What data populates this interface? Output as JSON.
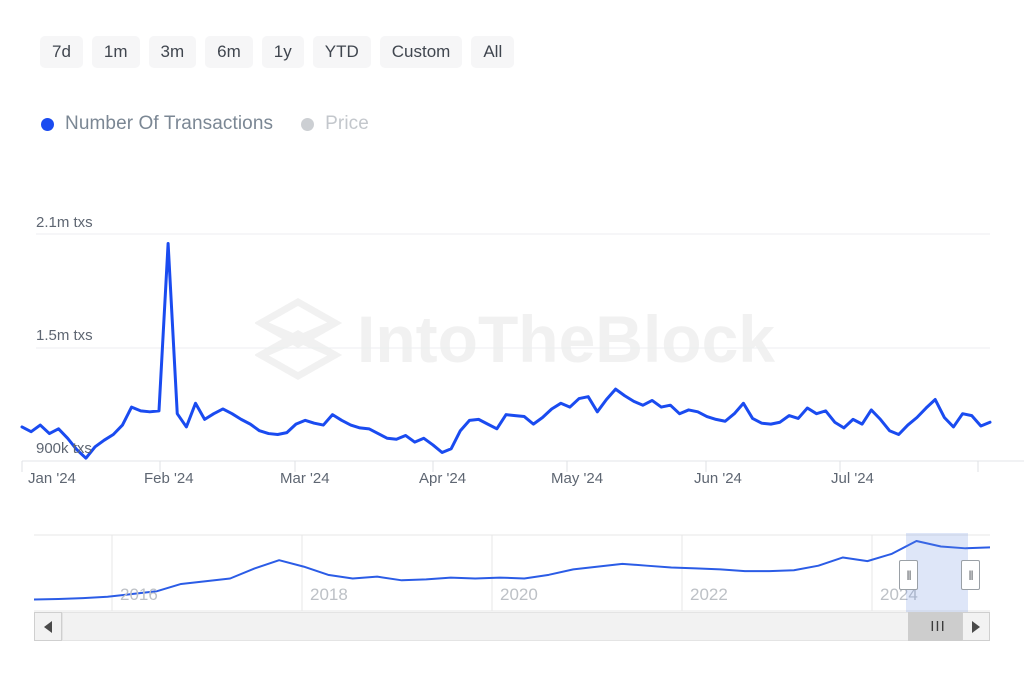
{
  "range_selector": {
    "buttons": [
      {
        "label": "7d",
        "selected": false
      },
      {
        "label": "1m",
        "selected": false
      },
      {
        "label": "3m",
        "selected": false
      },
      {
        "label": "6m",
        "selected": true
      },
      {
        "label": "1y",
        "selected": false
      },
      {
        "label": "YTD",
        "selected": false
      },
      {
        "label": "Custom",
        "selected": false
      },
      {
        "label": "All",
        "selected": false
      }
    ]
  },
  "legend": {
    "items": [
      {
        "label": "Number Of Transactions",
        "color": "#1a4bf0",
        "active": true
      },
      {
        "label": "Price",
        "color": "#cccfd3",
        "active": false
      }
    ]
  },
  "watermark": {
    "text": "IntoTheBlock",
    "color": "#f2f2f2"
  },
  "navigator": {
    "year_labels": [
      "2016",
      "2018",
      "2020",
      "2022",
      "2024"
    ],
    "handle_glyph": "‖",
    "selection_start_label": "2024",
    "selection_color": "#6b8edf"
  },
  "scrollbar": {
    "left_arrow": "◀",
    "right_arrow": "▶",
    "thumb_grip": "III"
  },
  "chart_data": {
    "type": "line",
    "title": "",
    "xlabel": "",
    "ylabel": "Number Of Transactions",
    "series_name": "Number Of Transactions",
    "line_color": "#1a4bf0",
    "grid": true,
    "legend_position": "top-left",
    "ytick_labels": [
      "2.1m txs",
      "1.5m txs",
      "900k txs"
    ],
    "ytick_values": [
      2100000,
      1500000,
      900000
    ],
    "ylim": [
      900000,
      2100000
    ],
    "xtick_labels": [
      "Jan '24",
      "Feb '24",
      "Mar '24",
      "Apr '24",
      "May '24",
      "Jun '24",
      "Jul '24"
    ],
    "xlim": [
      "2024-01-01",
      "2024-07-31"
    ],
    "x": [
      "2024-01-01",
      "2024-01-03",
      "2024-01-05",
      "2024-01-07",
      "2024-01-09",
      "2024-01-11",
      "2024-01-13",
      "2024-01-15",
      "2024-01-17",
      "2024-01-19",
      "2024-01-21",
      "2024-01-23",
      "2024-01-25",
      "2024-01-27",
      "2024-01-29",
      "2024-01-31",
      "2024-02-02",
      "2024-02-04",
      "2024-02-06",
      "2024-02-08",
      "2024-02-10",
      "2024-02-12",
      "2024-02-14",
      "2024-02-16",
      "2024-02-18",
      "2024-02-20",
      "2024-02-22",
      "2024-02-24",
      "2024-02-26",
      "2024-02-28",
      "2024-03-01",
      "2024-03-03",
      "2024-03-05",
      "2024-03-07",
      "2024-03-09",
      "2024-03-11",
      "2024-03-13",
      "2024-03-15",
      "2024-03-17",
      "2024-03-19",
      "2024-03-21",
      "2024-03-23",
      "2024-03-25",
      "2024-03-27",
      "2024-03-29",
      "2024-03-31",
      "2024-04-02",
      "2024-04-04",
      "2024-04-06",
      "2024-04-08",
      "2024-04-10",
      "2024-04-12",
      "2024-04-14",
      "2024-04-16",
      "2024-04-18",
      "2024-04-20",
      "2024-04-22",
      "2024-04-24",
      "2024-04-26",
      "2024-04-28",
      "2024-04-30",
      "2024-05-02",
      "2024-05-04",
      "2024-05-06",
      "2024-05-08",
      "2024-05-10",
      "2024-05-12",
      "2024-05-14",
      "2024-05-16",
      "2024-05-18",
      "2024-05-20",
      "2024-05-22",
      "2024-05-24",
      "2024-05-26",
      "2024-05-28",
      "2024-05-30",
      "2024-06-01",
      "2024-06-03",
      "2024-06-05",
      "2024-06-07",
      "2024-06-09",
      "2024-06-11",
      "2024-06-13",
      "2024-06-15",
      "2024-06-17",
      "2024-06-19",
      "2024-06-21",
      "2024-06-23",
      "2024-06-25",
      "2024-06-27",
      "2024-06-29",
      "2024-07-01",
      "2024-07-03",
      "2024-07-05",
      "2024-07-07",
      "2024-07-09",
      "2024-07-11",
      "2024-07-13",
      "2024-07-15",
      "2024-07-17",
      "2024-07-19",
      "2024-07-21",
      "2024-07-23",
      "2024-07-25",
      "2024-07-27",
      "2024-07-29",
      "2024-07-31"
    ],
    "values": [
      1080000,
      1055000,
      1090000,
      1045000,
      1070000,
      1020000,
      960000,
      915000,
      975000,
      1010000,
      1040000,
      1090000,
      1185000,
      1165000,
      1160000,
      1165000,
      2050000,
      1150000,
      1080000,
      1205000,
      1120000,
      1150000,
      1175000,
      1150000,
      1120000,
      1095000,
      1060000,
      1045000,
      1040000,
      1050000,
      1095000,
      1115000,
      1100000,
      1090000,
      1145000,
      1115000,
      1090000,
      1075000,
      1070000,
      1045000,
      1020000,
      1015000,
      1035000,
      1000000,
      1020000,
      985000,
      945000,
      965000,
      1060000,
      1115000,
      1120000,
      1095000,
      1070000,
      1145000,
      1140000,
      1135000,
      1095000,
      1130000,
      1175000,
      1205000,
      1185000,
      1230000,
      1240000,
      1160000,
      1225000,
      1280000,
      1245000,
      1215000,
      1195000,
      1220000,
      1185000,
      1195000,
      1150000,
      1170000,
      1160000,
      1135000,
      1120000,
      1110000,
      1150000,
      1205000,
      1125000,
      1100000,
      1095000,
      1105000,
      1140000,
      1125000,
      1180000,
      1150000,
      1165000,
      1105000,
      1075000,
      1120000,
      1095000,
      1170000,
      1120000,
      1060000,
      1040000,
      1090000,
      1130000,
      1180000,
      1225000,
      1130000,
      1080000,
      1150000,
      1140000,
      1085000,
      1105000
    ],
    "navigator_series": {
      "xlim": [
        "2014-01-01",
        "2024-08-01"
      ],
      "x": [
        "2014-01-01",
        "2014-07-01",
        "2015-01-01",
        "2015-07-01",
        "2016-01-01",
        "2016-07-01",
        "2017-01-01",
        "2017-04-01",
        "2017-07-01",
        "2017-10-01",
        "2017-12-01",
        "2018-01-01",
        "2018-03-01",
        "2018-06-01",
        "2018-09-01",
        "2018-12-01",
        "2019-03-01",
        "2019-06-01",
        "2019-09-01",
        "2019-12-01",
        "2020-03-01",
        "2020-06-01",
        "2020-09-01",
        "2020-12-01",
        "2021-03-01",
        "2021-06-01",
        "2021-09-01",
        "2021-12-01",
        "2022-03-01",
        "2022-06-01",
        "2022-09-01",
        "2022-12-01",
        "2023-03-01",
        "2023-06-01",
        "2023-09-01",
        "2023-12-01",
        "2024-02-01",
        "2024-04-01",
        "2024-06-01",
        "2024-08-01"
      ],
      "values": [
        60000,
        65000,
        75000,
        90000,
        120000,
        150000,
        230000,
        260000,
        290000,
        400000,
        490000,
        420000,
        330000,
        290000,
        310000,
        270000,
        280000,
        300000,
        290000,
        300000,
        290000,
        330000,
        390000,
        420000,
        450000,
        430000,
        410000,
        400000,
        390000,
        370000,
        370000,
        380000,
        430000,
        520000,
        480000,
        560000,
        700000,
        640000,
        620000,
        630000
      ]
    }
  }
}
